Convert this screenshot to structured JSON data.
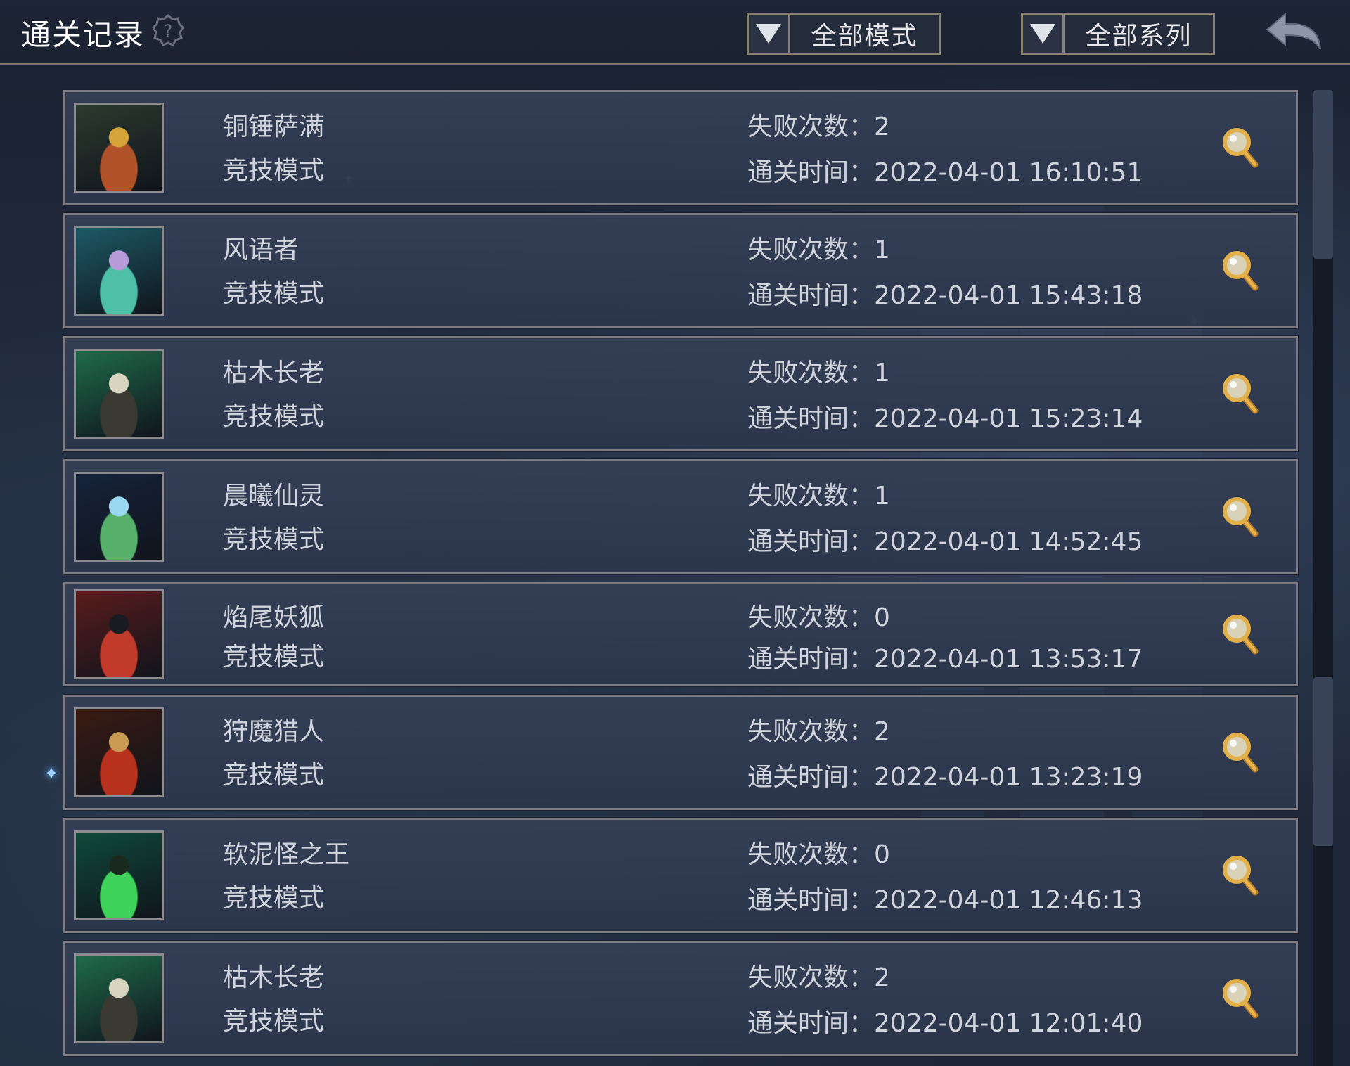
{
  "header": {
    "title": "通关记录",
    "help_icon": "question-gear-icon",
    "mode_filter": "全部模式",
    "series_filter": "全部系列",
    "back_icon": "back-arrow-icon"
  },
  "labels": {
    "fails_prefix": "失败次数：",
    "time_prefix": "通关时间："
  },
  "records": [
    {
      "name": "铜锤萨满",
      "mode": "竞技模式",
      "fails": "2",
      "time": "2022-04-01 16:10:51",
      "portrait_colors": [
        "#2c3a2e",
        "#b0532a",
        "#d7a43a"
      ]
    },
    {
      "name": "风语者",
      "mode": "竞技模式",
      "fails": "1",
      "time": "2022-04-01 15:43:18",
      "portrait_colors": [
        "#1d5a66",
        "#4fc0a8",
        "#b79ad8"
      ]
    },
    {
      "name": "枯木长老",
      "mode": "竞技模式",
      "fails": "1",
      "time": "2022-04-01 15:23:14",
      "portrait_colors": [
        "#1f6b4a",
        "#3a3a32",
        "#d9d4c0"
      ]
    },
    {
      "name": "晨曦仙灵",
      "mode": "竞技模式",
      "fails": "1",
      "time": "2022-04-01 14:52:45",
      "portrait_colors": [
        "#16233a",
        "#56b06a",
        "#9ad7f0"
      ]
    },
    {
      "name": "焰尾妖狐",
      "mode": "竞技模式",
      "fails": "0",
      "time": "2022-04-01 13:53:17",
      "portrait_colors": [
        "#5a1c1c",
        "#c23a2a",
        "#1b1b22"
      ]
    },
    {
      "name": "狩魔猎人",
      "mode": "竞技模式",
      "fails": "2",
      "time": "2022-04-01 13:23:19",
      "portrait_colors": [
        "#3a1a12",
        "#b8321e",
        "#c89a52"
      ]
    },
    {
      "name": "软泥怪之王",
      "mode": "竞技模式",
      "fails": "0",
      "time": "2022-04-01 12:46:13",
      "portrait_colors": [
        "#0f4a3a",
        "#3fd25a",
        "#1b2a1e"
      ]
    },
    {
      "name": "枯木长老",
      "mode": "竞技模式",
      "fails": "2",
      "time": "2022-04-01 12:01:40",
      "portrait_colors": [
        "#1f6b4a",
        "#3a3a32",
        "#d9d4c0"
      ]
    }
  ],
  "colors": {
    "accent_gold": "#e2b04a",
    "frame": "#8a8270"
  }
}
